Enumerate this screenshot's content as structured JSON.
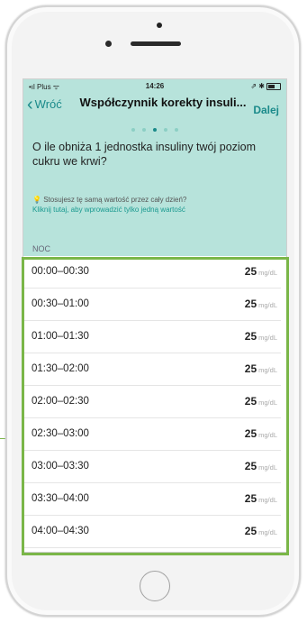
{
  "status_bar": {
    "carrier": "•ıl Plus ᯤ",
    "time": "14:26",
    "right_icons": "⇗ ✱"
  },
  "nav": {
    "back_label": "Wróć",
    "title": "Współczynnik korekty insuli...",
    "next_label": "Dalej"
  },
  "progress": {
    "total_steps": 5,
    "active_step": 3
  },
  "question": "O ile obniża 1 jednostka insuliny twój poziom cukru we krwi?",
  "hint": {
    "line1": "Stosujesz tę samą wartość przez cały dzień?",
    "line2": "Kliknij tutaj, aby wprowadzić tylko jedną wartość"
  },
  "section_label": "NOC",
  "unit": "mg/dL",
  "rows": [
    {
      "range": "00:00–00:30",
      "value": "25"
    },
    {
      "range": "00:30–01:00",
      "value": "25"
    },
    {
      "range": "01:00–01:30",
      "value": "25"
    },
    {
      "range": "01:30–02:00",
      "value": "25"
    },
    {
      "range": "02:00–02:30",
      "value": "25"
    },
    {
      "range": "02:30–03:00",
      "value": "25"
    },
    {
      "range": "03:00–03:30",
      "value": "25"
    },
    {
      "range": "03:30–04:00",
      "value": "25"
    },
    {
      "range": "04:00–04:30",
      "value": "25"
    }
  ],
  "colors": {
    "header_bg": "#b7e3db",
    "accent": "#1a8a8a",
    "highlight_border": "#7ab648"
  }
}
